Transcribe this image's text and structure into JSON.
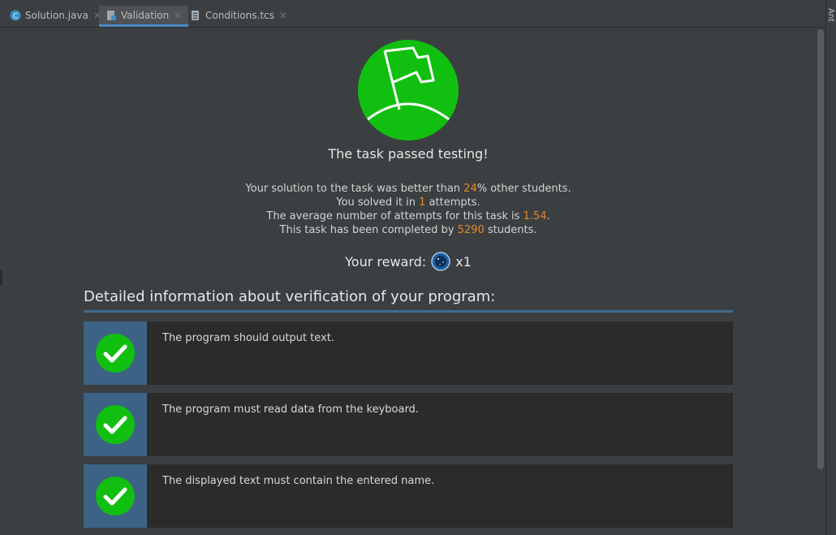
{
  "tabs": [
    {
      "label": "Solution.java",
      "icon": "java-class-icon",
      "active": false
    },
    {
      "label": "Validation",
      "icon": "validation-doc-icon",
      "active": true
    },
    {
      "label": "Conditions.tcs",
      "icon": "document-icon",
      "active": false
    }
  ],
  "right_strip": {
    "label": "Ant"
  },
  "result": {
    "title": "The task passed testing!",
    "line1_pre": "Your solution to the task was better than ",
    "line1_num": "24",
    "line1_post": "% other students.",
    "line2_pre": "You solved it in ",
    "line2_num": "1",
    "line2_post": " attempts.",
    "line3_pre": "The average number of attempts for this task is ",
    "line3_num": "1.54",
    "line3_post": ".",
    "line4_pre": "This task has been completed by ",
    "line4_num": "5290",
    "line4_post": " students."
  },
  "reward": {
    "label": "Your reward:",
    "multiplier": "x1",
    "icon": "dark-matter-coin-icon"
  },
  "details": {
    "heading": "Detailed information about verification of your program:",
    "checks": [
      "The program should output text.",
      "The program must read data from the keyboard.",
      "The displayed text must contain the entered name."
    ]
  },
  "colors": {
    "accent_green": "#11bf11",
    "highlight_number": "#e08a2c",
    "section_rule": "#3f6a8f"
  }
}
